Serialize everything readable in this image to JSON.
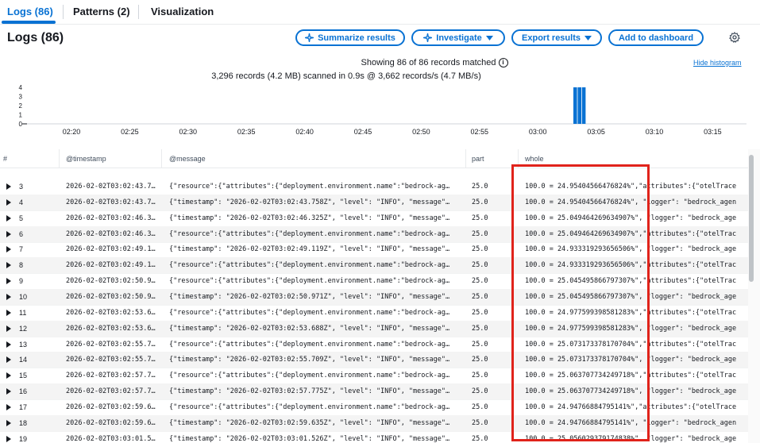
{
  "tabs": [
    {
      "label": "Logs (86)"
    },
    {
      "label": "Patterns (2)"
    },
    {
      "label": "Visualization"
    }
  ],
  "header": {
    "title": "Logs (86)",
    "buttons": {
      "summarize": "Summarize results",
      "investigate": "Investigate",
      "export": "Export results",
      "dashboard": "Add to dashboard"
    }
  },
  "summary": {
    "matched": "Showing 86 of 86 records matched",
    "scanned": "3,296 records (4.2 MB) scanned in 0.9s @ 3,662 records/s (4.7 MB/s)",
    "hide_histogram": "Hide histogram"
  },
  "histogram": {
    "y_ticks": [
      "4",
      "3",
      "2",
      "1",
      "0"
    ],
    "x_ticks": [
      "02:20",
      "02:25",
      "02:30",
      "02:35",
      "02:40",
      "02:45",
      "02:50",
      "02:55",
      "03:00",
      "03:05",
      "03:10",
      "03:15"
    ],
    "bar_values": [
      4,
      4,
      4
    ],
    "bar_color": "#0972d3",
    "ymax": 4
  },
  "table": {
    "columns": {
      "num": "#",
      "timestamp": "@timestamp",
      "message": "@message",
      "part": "part",
      "whole": "whole"
    },
    "rows": [
      {
        "n": "3",
        "ts": "2026-02-02T03:02:43.7…",
        "msg": "{\"resource\":{\"attributes\":{\"deployment.environment.name\":\"bedrock-ag…",
        "part": "25.0",
        "whole": "100.0 = 24.95404566476824%\",\"attributes\":{\"otelTrace"
      },
      {
        "n": "4",
        "ts": "2026-02-02T03:02:43.7…",
        "msg": "{\"timestamp\": \"2026-02-02T03:02:43.758Z\", \"level\": \"INFO\", \"message\"…",
        "part": "25.0",
        "whole": "100.0 = 24.95404566476824%\", \"logger\": \"bedrock_agen"
      },
      {
        "n": "5",
        "ts": "2026-02-02T03:02:46.3…",
        "msg": "{\"timestamp\": \"2026-02-02T03:02:46.325Z\", \"level\": \"INFO\", \"message\"…",
        "part": "25.0",
        "whole": "100.0 = 25.049464269634907%\", \"logger\": \"bedrock_age"
      },
      {
        "n": "6",
        "ts": "2026-02-02T03:02:46.3…",
        "msg": "{\"resource\":{\"attributes\":{\"deployment.environment.name\":\"bedrock-ag…",
        "part": "25.0",
        "whole": "100.0 = 25.049464269634907%\",\"attributes\":{\"otelTrac"
      },
      {
        "n": "7",
        "ts": "2026-02-02T03:02:49.1…",
        "msg": "{\"timestamp\": \"2026-02-02T03:02:49.119Z\", \"level\": \"INFO\", \"message\"…",
        "part": "25.0",
        "whole": "100.0 = 24.933319293656506%\", \"logger\": \"bedrock_age"
      },
      {
        "n": "8",
        "ts": "2026-02-02T03:02:49.1…",
        "msg": "{\"resource\":{\"attributes\":{\"deployment.environment.name\":\"bedrock-ag…",
        "part": "25.0",
        "whole": "100.0 = 24.933319293656506%\",\"attributes\":{\"otelTrac"
      },
      {
        "n": "9",
        "ts": "2026-02-02T03:02:50.9…",
        "msg": "{\"resource\":{\"attributes\":{\"deployment.environment.name\":\"bedrock-ag…",
        "part": "25.0",
        "whole": "100.0 = 25.045495866797307%\",\"attributes\":{\"otelTrac"
      },
      {
        "n": "10",
        "ts": "2026-02-02T03:02:50.9…",
        "msg": "{\"timestamp\": \"2026-02-02T03:02:50.971Z\", \"level\": \"INFO\", \"message\"…",
        "part": "25.0",
        "whole": "100.0 = 25.045495866797307%\", \"logger\": \"bedrock_age"
      },
      {
        "n": "11",
        "ts": "2026-02-02T03:02:53.6…",
        "msg": "{\"resource\":{\"attributes\":{\"deployment.environment.name\":\"bedrock-ag…",
        "part": "25.0",
        "whole": "100.0 = 24.977599398581283%\",\"attributes\":{\"otelTrac"
      },
      {
        "n": "12",
        "ts": "2026-02-02T03:02:53.6…",
        "msg": "{\"timestamp\": \"2026-02-02T03:02:53.688Z\", \"level\": \"INFO\", \"message\"…",
        "part": "25.0",
        "whole": "100.0 = 24.977599398581283%\", \"logger\": \"bedrock_age"
      },
      {
        "n": "13",
        "ts": "2026-02-02T03:02:55.7…",
        "msg": "{\"resource\":{\"attributes\":{\"deployment.environment.name\":\"bedrock-ag…",
        "part": "25.0",
        "whole": "100.0 = 25.073173378170704%\",\"attributes\":{\"otelTrac"
      },
      {
        "n": "14",
        "ts": "2026-02-02T03:02:55.7…",
        "msg": "{\"timestamp\": \"2026-02-02T03:02:55.709Z\", \"level\": \"INFO\", \"message\"…",
        "part": "25.0",
        "whole": "100.0 = 25.073173378170704%\", \"logger\": \"bedrock_age"
      },
      {
        "n": "15",
        "ts": "2026-02-02T03:02:57.7…",
        "msg": "{\"resource\":{\"attributes\":{\"deployment.environment.name\":\"bedrock-ag…",
        "part": "25.0",
        "whole": "100.0 = 25.063707734249718%\",\"attributes\":{\"otelTrac"
      },
      {
        "n": "16",
        "ts": "2026-02-02T03:02:57.7…",
        "msg": "{\"timestamp\": \"2026-02-02T03:02:57.775Z\", \"level\": \"INFO\", \"message\"…",
        "part": "25.0",
        "whole": "100.0 = 25.063707734249718%\", \"logger\": \"bedrock_age"
      },
      {
        "n": "17",
        "ts": "2026-02-02T03:02:59.6…",
        "msg": "{\"resource\":{\"attributes\":{\"deployment.environment.name\":\"bedrock-ag…",
        "part": "25.0",
        "whole": "100.0 = 24.94766884795141%\",\"attributes\":{\"otelTrace"
      },
      {
        "n": "18",
        "ts": "2026-02-02T03:02:59.6…",
        "msg": "{\"timestamp\": \"2026-02-02T03:02:59.635Z\", \"level\": \"INFO\", \"message\"…",
        "part": "25.0",
        "whole": "100.0 = 24.94766884795141%\", \"logger\": \"bedrock_agen"
      },
      {
        "n": "19",
        "ts": "2026-02-02T03:03:01.5…",
        "msg": "{\"timestamp\": \"2026-02-02T03:03:01.526Z\", \"level\": \"INFO\", \"message\"…",
        "part": "25.0",
        "whole": "100.0 = 25.056029379174838%\", \"logger\": \"bedrock_age"
      }
    ]
  }
}
